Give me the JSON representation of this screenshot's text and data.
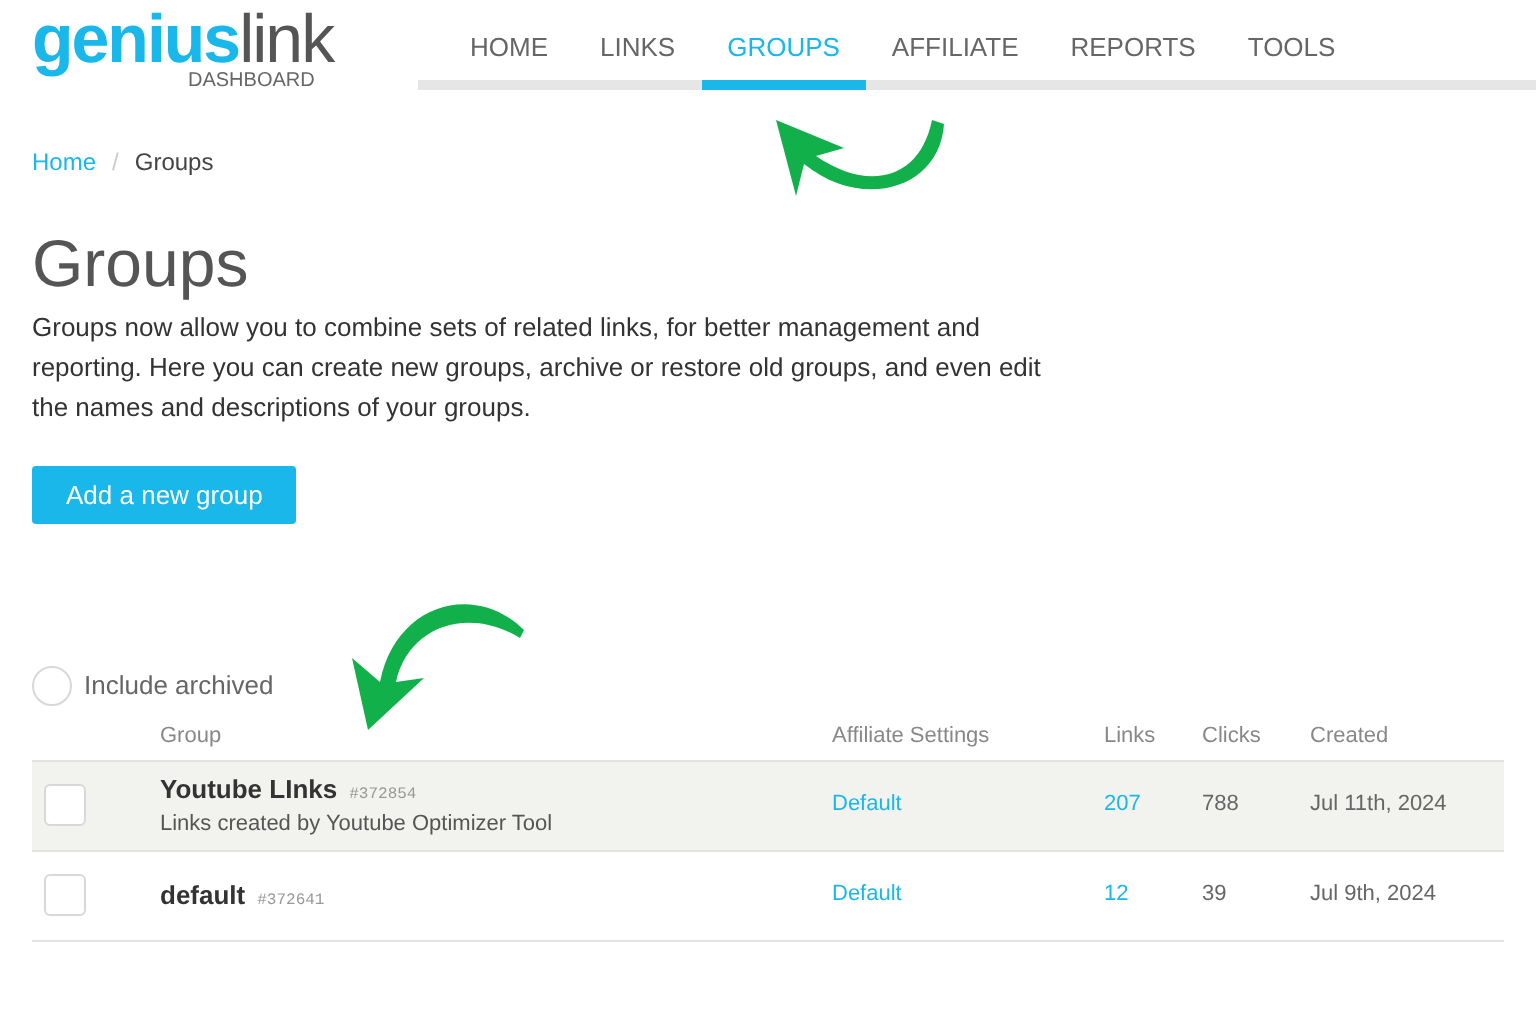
{
  "logo": {
    "part1": "genius",
    "part2": "link",
    "subtitle": "DASHBOARD"
  },
  "nav": [
    {
      "label": "HOME",
      "selected": false
    },
    {
      "label": "LINKS",
      "selected": false
    },
    {
      "label": "GROUPS",
      "selected": true
    },
    {
      "label": "AFFILIATE",
      "selected": false
    },
    {
      "label": "REPORTS",
      "selected": false
    },
    {
      "label": "TOOLS",
      "selected": false
    }
  ],
  "breadcrumb": {
    "items": [
      "Home",
      "Groups"
    ],
    "separator": "/"
  },
  "title": "Groups",
  "description": "Groups now allow you to combine sets of related links, for better management and reporting. Here you can create new groups, archive or restore old groups, and even edit the names and descriptions of your groups.",
  "add_button": "Add a new group",
  "include_archived": {
    "label": "Include archived",
    "checked": false
  },
  "table": {
    "columns": [
      "Group",
      "Affiliate Settings",
      "Links",
      "Clicks",
      "Created"
    ],
    "rows": [
      {
        "checked": false,
        "highlighted": true,
        "name": "Youtube LInks",
        "id": "#372854",
        "description": "Links created by Youtube Optimizer Tool",
        "affiliate": "Default",
        "links": "207",
        "clicks": "788",
        "created": "Jul 11th, 2024"
      },
      {
        "checked": false,
        "highlighted": false,
        "name": "default",
        "id": "#372641",
        "affiliate": "Default",
        "links": "12",
        "clicks": "39",
        "created": "Jul 9th, 2024"
      }
    ]
  }
}
